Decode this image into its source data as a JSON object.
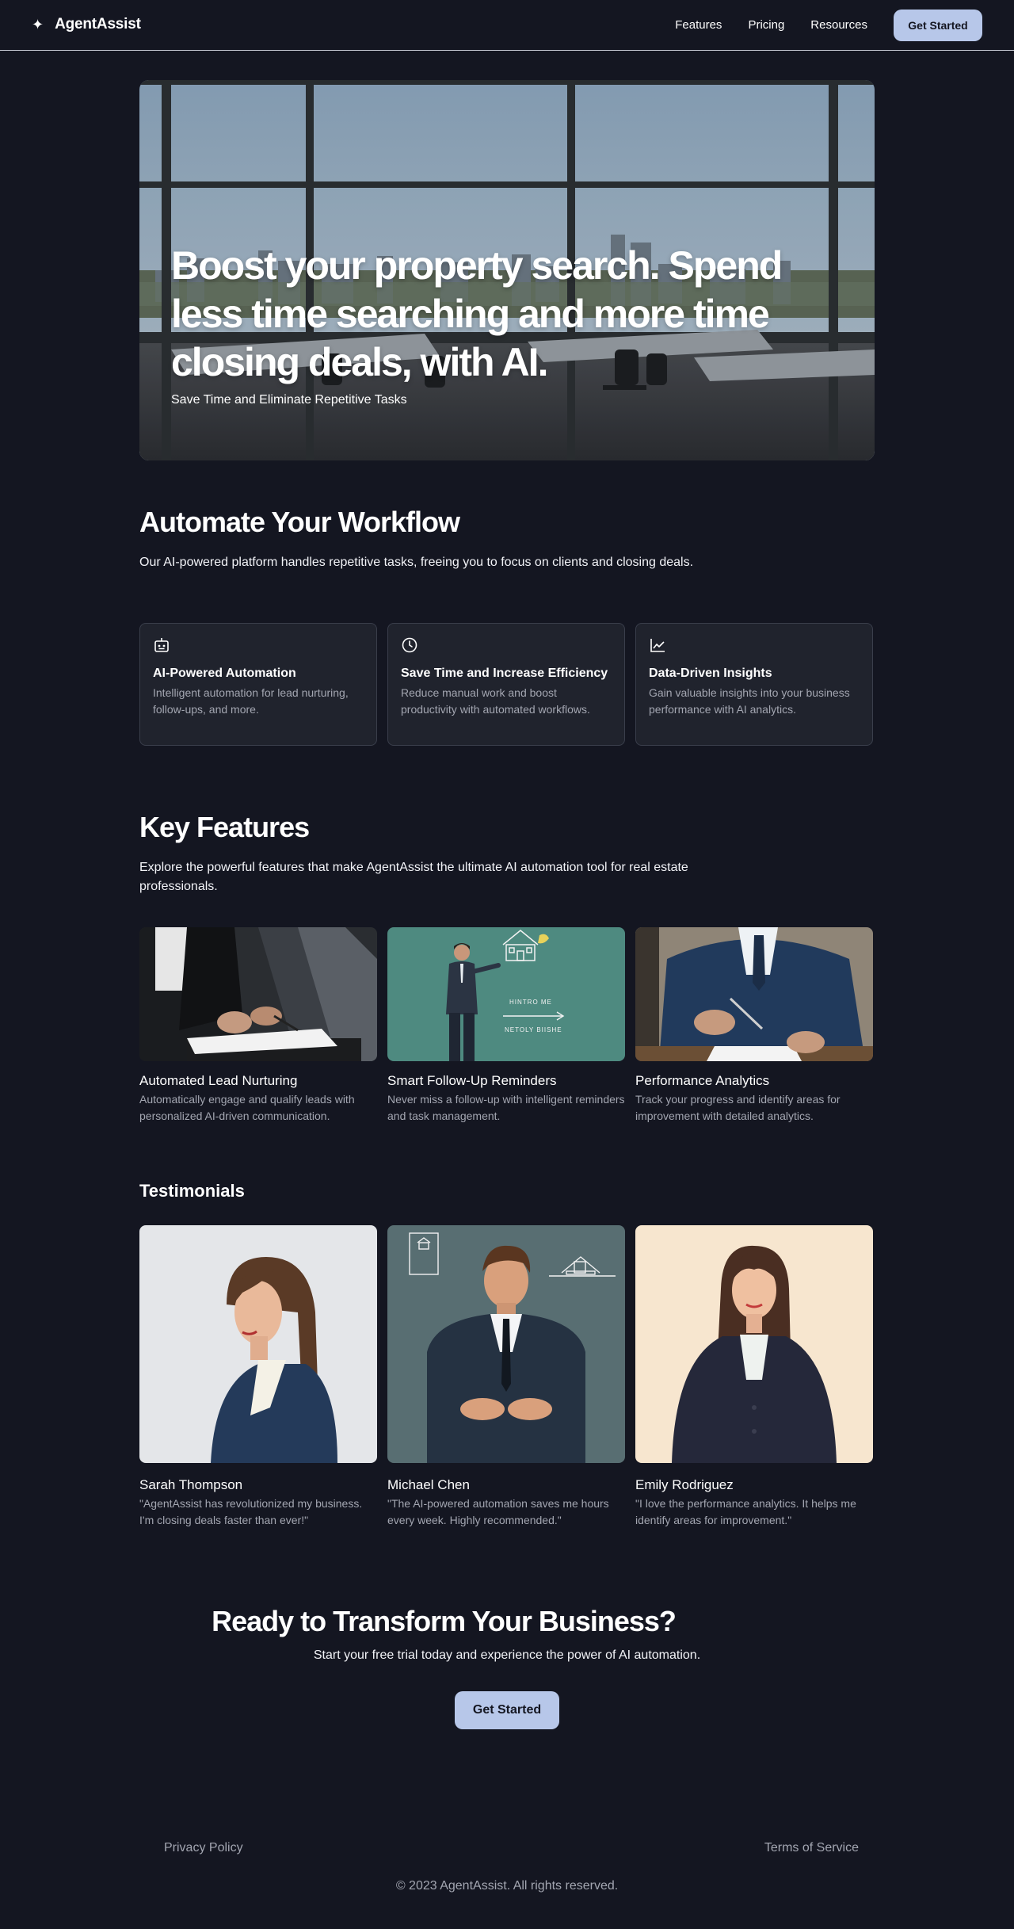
{
  "nav": {
    "brand_icon": "sparkle-icon",
    "brand": "AgentAssist",
    "links": [
      "Features",
      "Pricing",
      "Resources"
    ],
    "cta": "Get Started"
  },
  "hero": {
    "title": "Boost your property search. Spend less time searching and more time closing deals, with AI.",
    "subtitle": "Save Time and Eliminate Repetitive Tasks"
  },
  "workflow": {
    "title": "Automate Your Workflow",
    "description": "Our AI-powered platform handles repetitive tasks, freeing you to focus on clients and closing deals.",
    "cards": [
      {
        "icon": "robot-icon",
        "title": "AI-Powered Automation",
        "description": "Intelligent automation for lead nurturing, follow-ups, and more."
      },
      {
        "icon": "clock-icon",
        "title": "Save Time and Increase Efficiency",
        "description": "Reduce manual work and boost productivity with automated workflows."
      },
      {
        "icon": "chart-line-icon",
        "title": "Data-Driven Insights",
        "description": "Gain valuable insights into your business performance with AI analytics."
      }
    ]
  },
  "features": {
    "title": "Key Features",
    "description": "Explore the powerful features that make AgentAssist the ultimate AI automation tool for real estate professionals.",
    "items": [
      {
        "title": "Automated Lead Nurturing",
        "description": "Automatically engage and qualify leads with personalized AI-driven communication."
      },
      {
        "title": "Smart Follow-Up Reminders",
        "description": "Never miss a follow-up with intelligent reminders and task management.",
        "image_text": [
          "HINTRO ME",
          "NETOLY BIISHE"
        ]
      },
      {
        "title": "Performance Analytics",
        "description": "Track your progress and identify areas for improvement with detailed analytics."
      }
    ]
  },
  "testimonials": {
    "title": "Testimonials",
    "items": [
      {
        "name": "Sarah Thompson",
        "quote": "\"AgentAssist has revolutionized my business. I'm closing deals faster than ever!\""
      },
      {
        "name": "Michael Chen",
        "quote": "\"The AI-powered automation saves me hours every week. Highly recommended.\""
      },
      {
        "name": "Emily Rodriguez",
        "quote": "\"I love the performance analytics. It helps me identify areas for improvement.\""
      }
    ]
  },
  "cta": {
    "title": "Ready to Transform Your Business?",
    "subtitle": "Start your free trial today and experience the power of AI automation.",
    "button": "Get Started"
  },
  "footer": {
    "privacy": "Privacy Policy",
    "terms": "Terms of Service",
    "copyright": "© 2023 AgentAssist. All rights reserved."
  },
  "colors": {
    "background": "#141621",
    "card": "#20232d",
    "accent": "#b7c7e9",
    "muted_text": "#a3a6b1"
  }
}
